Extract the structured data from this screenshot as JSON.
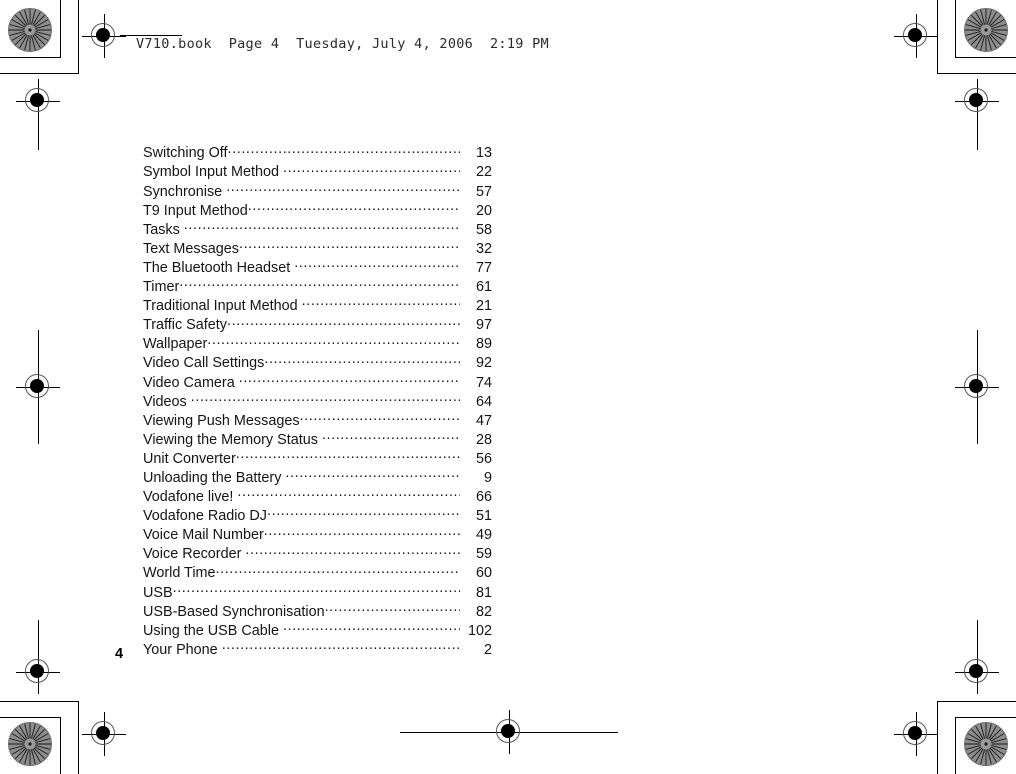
{
  "header": {
    "stamp": "V710.book  Page 4  Tuesday, July 4, 2006  2:19 PM"
  },
  "folio": {
    "page_number": "4"
  },
  "index": {
    "entries": [
      {
        "title": "Switching Off",
        "page": "13",
        "trailing_space": false
      },
      {
        "title": "Symbol Input Method",
        "page": "22",
        "trailing_space": true
      },
      {
        "title": "Synchronise",
        "page": "57",
        "trailing_space": true
      },
      {
        "title": "T9 Input Method",
        "page": "20",
        "trailing_space": false
      },
      {
        "title": "Tasks",
        "page": "58",
        "trailing_space": true
      },
      {
        "title": "Text Messages",
        "page": "32",
        "trailing_space": false
      },
      {
        "title": "The Bluetooth Headset",
        "page": "77",
        "trailing_space": true
      },
      {
        "title": "Timer",
        "page": "61",
        "trailing_space": false
      },
      {
        "title": "Traditional Input Method",
        "page": "21",
        "trailing_space": true
      },
      {
        "title": "Traffic Safety",
        "page": "97",
        "trailing_space": false
      },
      {
        "title": "Wallpaper",
        "page": "89",
        "trailing_space": false
      },
      {
        "title": "Video Call Settings",
        "page": "92",
        "trailing_space": false
      },
      {
        "title": "Video Camera",
        "page": "74",
        "trailing_space": true
      },
      {
        "title": "Videos",
        "page": "64",
        "trailing_space": true
      },
      {
        "title": "Viewing Push Messages",
        "page": "47",
        "trailing_space": false
      },
      {
        "title": "Viewing the Memory Status",
        "page": "28",
        "trailing_space": true
      },
      {
        "title": "Unit Converter",
        "page": "56",
        "trailing_space": false
      },
      {
        "title": "Unloading the Battery",
        "page": "9",
        "trailing_space": true
      },
      {
        "title": "Vodafone live!",
        "page": "66",
        "trailing_space": true
      },
      {
        "title": "Vodafone Radio DJ",
        "page": "51",
        "trailing_space": false
      },
      {
        "title": "Voice Mail Number",
        "page": "49",
        "trailing_space": false
      },
      {
        "title": "Voice Recorder",
        "page": "59",
        "trailing_space": true
      },
      {
        "title": "World Time",
        "page": "60",
        "trailing_space": false
      },
      {
        "title": "USB",
        "page": "81",
        "trailing_space": false
      },
      {
        "title": "USB-Based Synchronisation",
        "page": "82",
        "trailing_space": false
      },
      {
        "title": "Using the USB Cable",
        "page": "102",
        "trailing_space": true
      },
      {
        "title": "Your Phone",
        "page": "2",
        "trailing_space": true
      }
    ]
  },
  "print_marks": {
    "starburst_label": "radial-resolution-target",
    "registration_label": "registration-crosshair-target"
  }
}
